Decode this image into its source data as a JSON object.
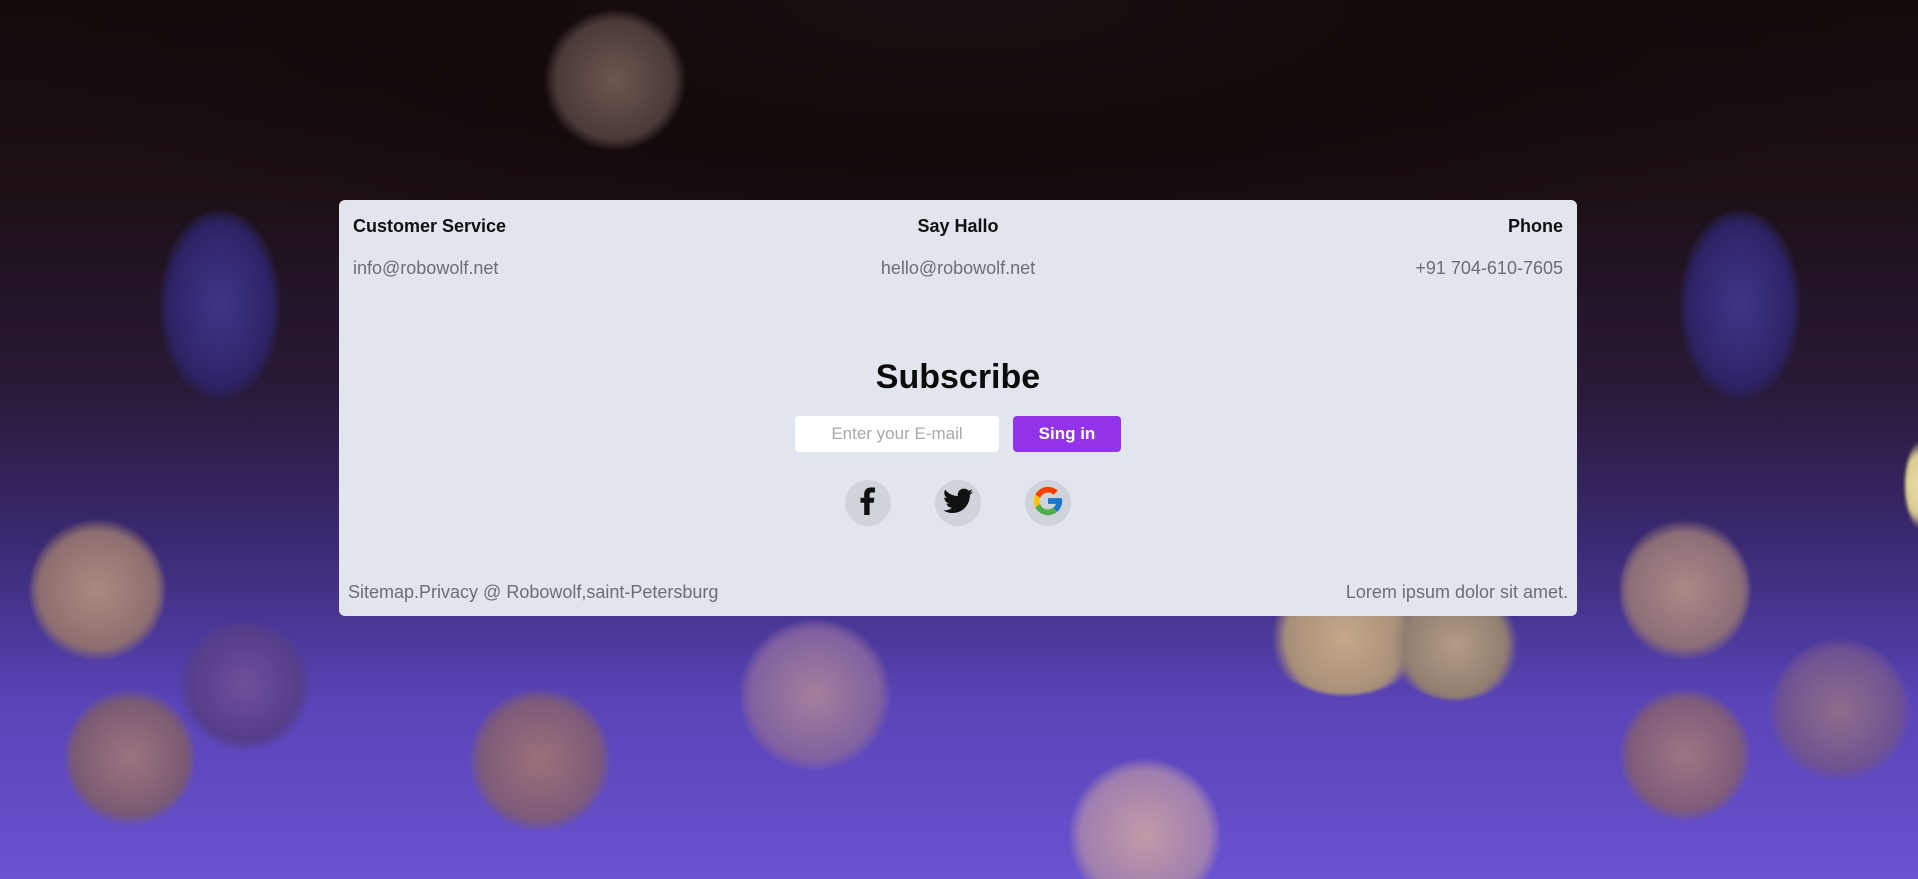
{
  "contacts": [
    {
      "title": "Customer Service",
      "value": "info@robowolf.net"
    },
    {
      "title": "Say Hallo",
      "value": "hello@robowolf.net"
    },
    {
      "title": "Phone",
      "value": "+91 704-610-7605"
    }
  ],
  "subscribe": {
    "title": "Subscribe",
    "email_placeholder": "Enter your E-mail",
    "email_value": "",
    "button_label": "Sing in"
  },
  "social": [
    {
      "icon": "facebook-icon"
    },
    {
      "icon": "twitter-icon"
    },
    {
      "icon": "google-icon"
    }
  ],
  "footer": {
    "left_text": "Sitemap.Privacy @ Robowolf,saint-Petersburg",
    "right_text": "Lorem ipsum dolor sit amet."
  },
  "colors": {
    "card_background": "#e1e6ee",
    "accent": "#9333ea"
  }
}
